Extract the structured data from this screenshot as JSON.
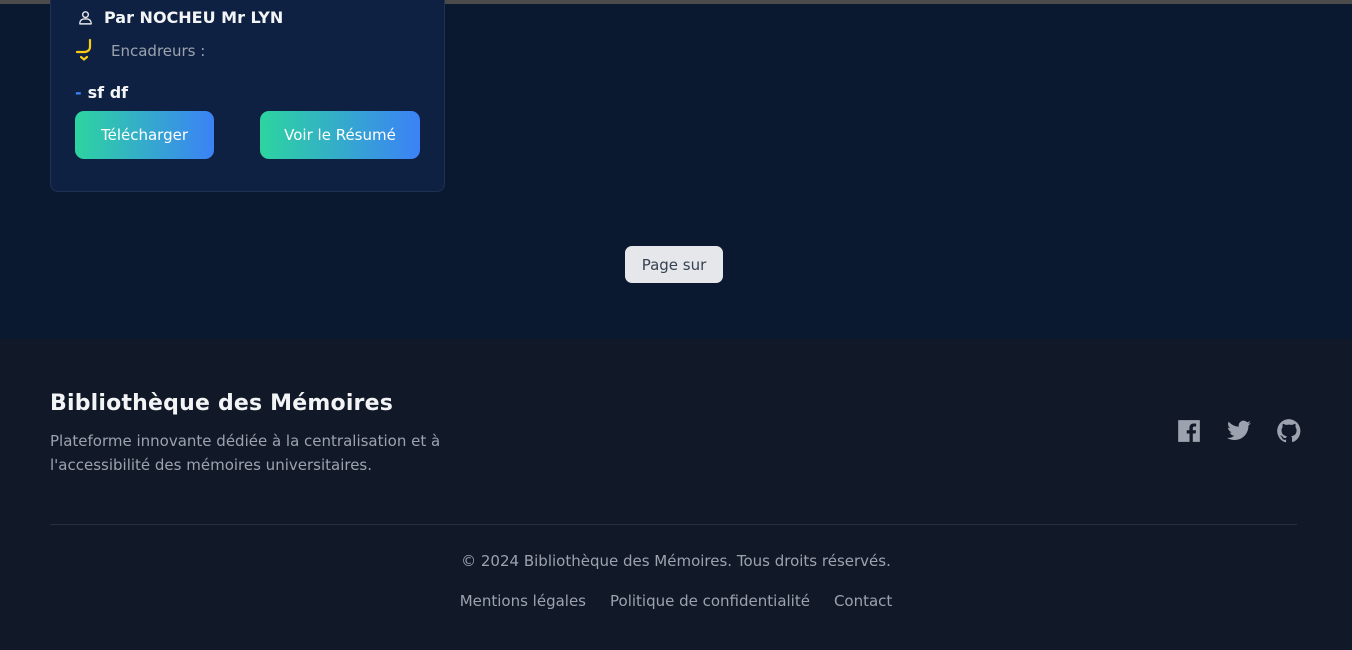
{
  "card": {
    "author": "Par NOCHEU Mr LYN",
    "supervisors_label": "Encadreurs :",
    "supervisor_dash": "-",
    "supervisor_name": "sf df",
    "download_label": "Télécharger",
    "summary_label": "Voir le Résumé"
  },
  "pagination": {
    "label": "Page sur"
  },
  "footer": {
    "brand": "Bibliothèque des Mémoires",
    "tagline": "Plateforme innovante dédiée à la centralisation et à l'accessibilité des mémoires universitaires.",
    "copyright": "© 2024 Bibliothèque des Mémoires. Tous droits réservés.",
    "links": [
      "Mentions légales",
      "Politique de confidentialité",
      "Contact"
    ],
    "socials": [
      "facebook-icon",
      "twitter-icon",
      "github-icon"
    ]
  },
  "colors": {
    "page_bg": "#0a1930",
    "card_bg": "#0f2142",
    "footer_bg": "#111827",
    "gradient_start": "#2dd4a0",
    "gradient_end": "#3b82f6",
    "accent_blue": "#3b82f6",
    "supervisor_icon": "#facc15"
  }
}
